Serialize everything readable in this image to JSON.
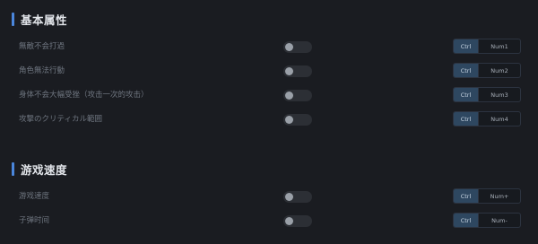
{
  "sections": [
    {
      "title": "基本属性",
      "rows": [
        {
          "label": "無敵不会打過",
          "mod": "Ctrl",
          "key": "Num1"
        },
        {
          "label": "角色無法行動",
          "mod": "Ctrl",
          "key": "Num2"
        },
        {
          "label": "身体不会大幅受挫（攻击一次的攻击）",
          "mod": "Ctrl",
          "key": "Num3"
        },
        {
          "label": "攻撃のクリティカル範囲",
          "mod": "Ctrl",
          "key": "Num4"
        }
      ]
    },
    {
      "title": "游戏速度",
      "rows": [
        {
          "label": "游戏速度",
          "mod": "Ctrl",
          "key": "Num+"
        },
        {
          "label": "子弹时间",
          "mod": "Ctrl",
          "key": "Num-"
        }
      ]
    }
  ],
  "colors": {
    "background": "#1a1c21",
    "accent": "#4a86dc",
    "hotkey_mod_bg": "#2e4760"
  },
  "icons": {
    "section_marker": "vertical-accent-bar"
  }
}
